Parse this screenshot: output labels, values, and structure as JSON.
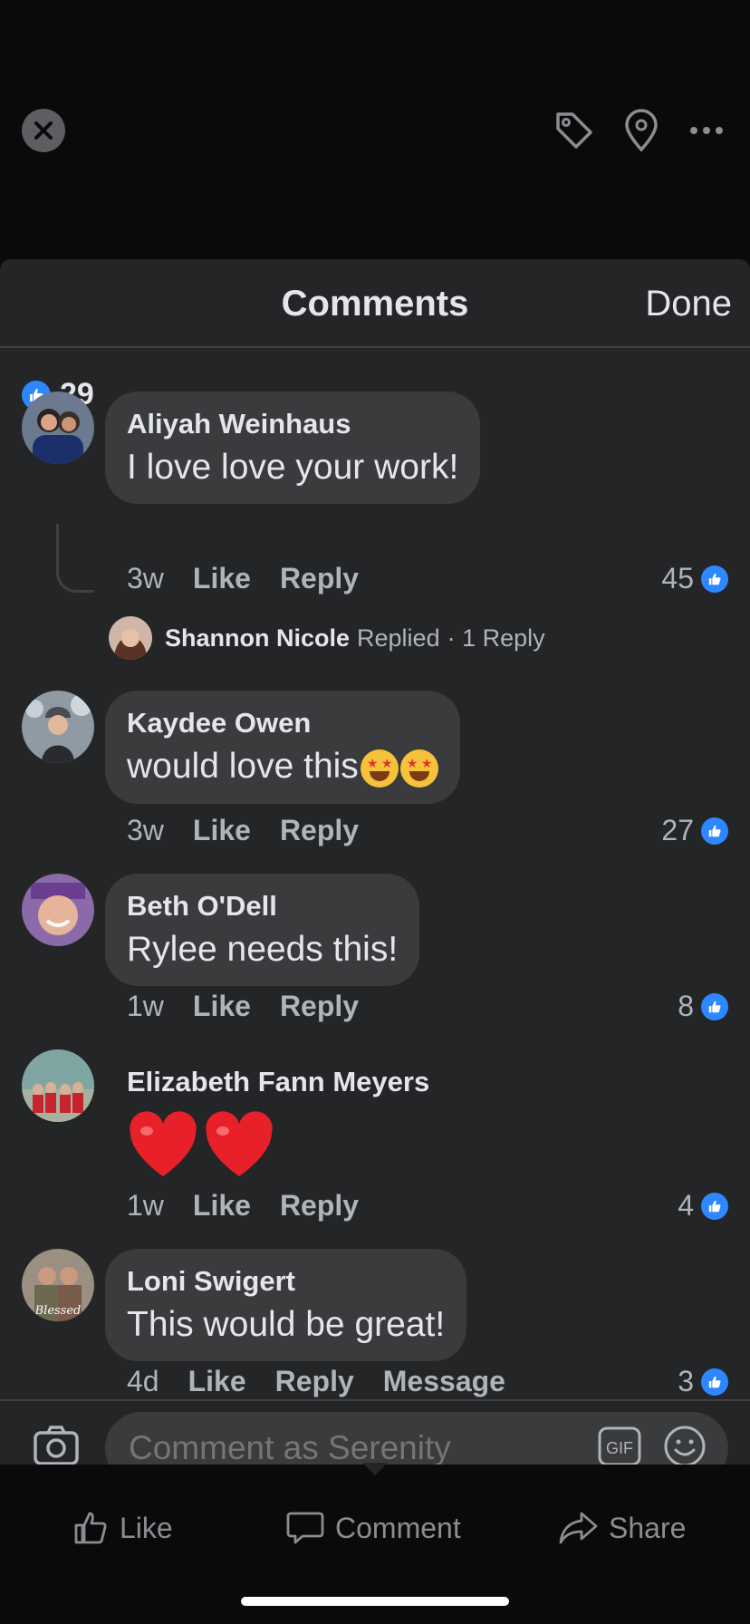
{
  "sheet": {
    "title": "Comments",
    "done_label": "Done"
  },
  "reactions": {
    "count": "29"
  },
  "comments": [
    {
      "name": "Aliyah Weinhaus",
      "text": "I love love your work!",
      "time": "3w",
      "like_label": "Like",
      "reply_label": "Reply",
      "likes": "45",
      "reply_preview": {
        "name": "Shannon Nicole",
        "action": "Replied",
        "count": "· 1 Reply"
      }
    },
    {
      "name": "Kaydee Owen",
      "text": "would love this",
      "time": "3w",
      "like_label": "Like",
      "reply_label": "Reply",
      "likes": "27"
    },
    {
      "name": "Beth O'Dell",
      "text": "Rylee needs this!",
      "time": "1w",
      "like_label": "Like",
      "reply_label": "Reply",
      "likes": "8"
    },
    {
      "name": "Elizabeth Fann Meyers",
      "text": "",
      "time": "1w",
      "like_label": "Like",
      "reply_label": "Reply",
      "likes": "4"
    },
    {
      "name": "Loni Swigert",
      "text": "This would be great!",
      "time": "4d",
      "like_label": "Like",
      "reply_label": "Reply",
      "message_label": "Message",
      "likes": "3",
      "avatar_caption": "Blessed"
    }
  ],
  "composer": {
    "placeholder": "Comment as Serenity",
    "gif_label": "GIF"
  },
  "actions": {
    "like": "Like",
    "comment": "Comment",
    "share": "Share"
  },
  "colors": {
    "accent": "#2d88ff",
    "sheet_bg": "#242526",
    "bubble_bg": "#3a3b3c",
    "heart": "#e8202a"
  }
}
